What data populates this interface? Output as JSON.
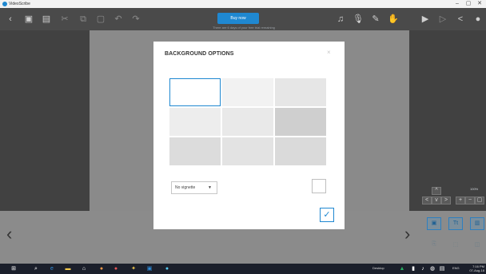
{
  "window": {
    "title": "VideoScribe",
    "controls": [
      "–",
      "▢",
      "✕"
    ]
  },
  "toolbar": {
    "buy_now_label": "Buy now",
    "trial_text": "There are 6 days of your free trial remaining",
    "icons_left": [
      "back-icon",
      "save-icon",
      "save-as-icon",
      "cut-icon",
      "copy-icon",
      "paste-icon",
      "undo-icon",
      "redo-icon"
    ],
    "icons_right": [
      "music-icon",
      "voiceover-icon",
      "pen-icon",
      "hand-icon",
      "play-icon",
      "preview-icon",
      "share-icon",
      "help-icon"
    ]
  },
  "dialog": {
    "title": "BACKGROUND OPTIONS",
    "close_glyph": "×",
    "vignette": {
      "selected": "No vignette",
      "arrow": "▼"
    },
    "ok_glyph": "✓",
    "swatches": [
      {
        "name": "swatch-white",
        "color": "#ffffff",
        "selected": true
      },
      {
        "name": "swatch-paper-light",
        "color": "#f2f2f2",
        "selected": false
      },
      {
        "name": "swatch-paper-mid",
        "color": "#e6e6e6",
        "selected": false
      },
      {
        "name": "swatch-paper-2",
        "color": "#ededed",
        "selected": false
      },
      {
        "name": "swatch-paper-3",
        "color": "#e9e9e9",
        "selected": false
      },
      {
        "name": "swatch-texture-dark",
        "color": "#cfcfcf",
        "selected": false
      },
      {
        "name": "swatch-noise",
        "color": "#dcdcdc",
        "selected": false
      },
      {
        "name": "swatch-paper-4",
        "color": "#e3e3e3",
        "selected": false
      },
      {
        "name": "swatch-crumpled",
        "color": "#dadada",
        "selected": false
      }
    ]
  },
  "right_panel": {
    "zoom_label": "100%",
    "nav_up": "^",
    "nav_down": "v",
    "bottom_buttons": [
      "Tt",
      "image",
      "chart"
    ]
  },
  "taskbar": {
    "tray_desktop": "Desktop",
    "lang": "ENG",
    "time": "7:16 PM",
    "date": "07-Aug-18"
  },
  "colors": {
    "accent": "#1f88d1",
    "toolbar_bg": "#4a4a4a",
    "canvas_bg": "#8a8a8a",
    "taskbar_bg": "#1b1f2b"
  }
}
